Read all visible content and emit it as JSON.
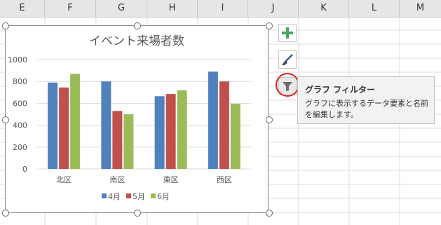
{
  "columns": [
    "E",
    "F",
    "G",
    "H",
    "I",
    "J",
    "K",
    "L",
    "M"
  ],
  "chart_data": {
    "type": "bar",
    "title": "イベント来場者数",
    "categories": [
      "北区",
      "南区",
      "東区",
      "西区"
    ],
    "series": [
      {
        "name": "4月",
        "color": "#4f81bd",
        "values": [
          790,
          800,
          665,
          890
        ]
      },
      {
        "name": "5月",
        "color": "#c0504d",
        "values": [
          745,
          530,
          685,
          800
        ]
      },
      {
        "name": "6月",
        "color": "#9bbb59",
        "values": [
          870,
          500,
          720,
          595
        ]
      }
    ],
    "yticks": [
      0,
      200,
      400,
      600,
      800,
      1000
    ],
    "ylim": [
      0,
      1000
    ],
    "legend_position": "bottom"
  },
  "side_buttons": {
    "elements_icon": "plus-icon",
    "styles_icon": "brush-icon",
    "filter_icon": "filter-icon"
  },
  "tooltip": {
    "title": "グラフ フィルター",
    "body": "グラフに表示するデータ要素と名前を編集します。"
  }
}
